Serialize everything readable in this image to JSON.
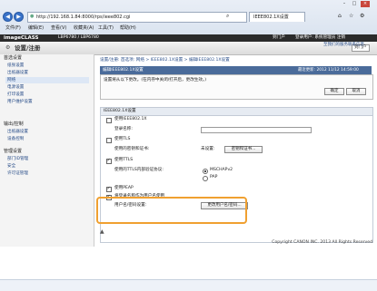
{
  "browser": {
    "address": "http://192.168.1.84:8000/rps/ieee802.cgi",
    "tab_title": "IEEE802.1X设置",
    "menu": [
      "文件(F)",
      "编辑(E)",
      "查看(V)",
      "收藏夹(A)",
      "工具(T)",
      "帮助(H)"
    ],
    "back_icon": "back-arrow-icon",
    "forward_icon": "forward-arrow-icon"
  },
  "app": {
    "brand": "imageCLASS",
    "model": "LBP6780 / LBP6780",
    "nav_label": "到门户",
    "user_label": "登录用户: 系统管理员 注销",
    "page_title": "设置/注册",
    "portal_button": "到门户",
    "contact_link": "至我们的服务联系信息",
    "accent": "#4a6b9a"
  },
  "sidebar": {
    "groups": [
      {
        "title": "首选设置",
        "items": [
          "纸张设置",
          "出纸器设置",
          "网络",
          "电源设置",
          "打印设置",
          "用户维护设置"
        ]
      },
      {
        "title": "输出/控制",
        "items": [
          "出纸器设置",
          "设备控制"
        ]
      },
      {
        "title": "管理设置",
        "items": [
          "部门ID管理",
          "安全",
          "许可证管理"
        ]
      }
    ],
    "selected_item": "网络"
  },
  "main": {
    "breadcrumb": "设置/注册: 首选项: 网络 > IEEE802.1X设置 > 编辑IEEE802.1X设置",
    "page_bar_title": "编辑IEEE802.1X设置",
    "page_bar_time": "最近更新: 2012 11/12 14:59:00",
    "info_text": "设置将从以下更改。(在内存中关闭/打开后，更改生效。)",
    "ok_button": "确定",
    "cancel_button": "取消",
    "section_title": "IEEE802.1X设置",
    "use_ieee_label": "使用IEEE802.1X",
    "login_name_label": "登录名称:",
    "use_tls_label": "使用TLS",
    "tls_key_label": "使用的密钥和证书:",
    "tls_key_value": "未设置:",
    "tls_key_button": "密钥和证书...",
    "use_ttls_label": "使用TTLS",
    "ttls_protocol_label": "使用的TTLS内部验证协议:",
    "ttls_options": [
      "MSCHAPv2",
      "PAP"
    ],
    "use_peap_label": "使用PEAP",
    "use_username_label": "将登录名称作为用户名使用",
    "username_pw_label": "用户名/密码设置:",
    "username_pw_button": "更改用户名/密码..."
  },
  "footer": {
    "copyright": "Copyright CANON INC. 2013 All Rights Reserved"
  }
}
